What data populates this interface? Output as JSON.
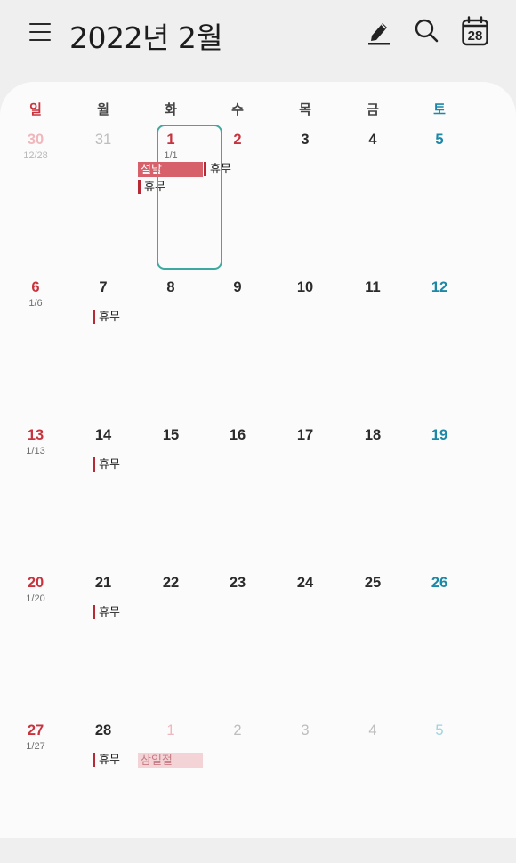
{
  "header": {
    "menu_icon": "menu-icon",
    "title": "2022년 2월",
    "today_label": "28",
    "icons": [
      "edit-pen-icon",
      "search-icon",
      "today-calendar-icon"
    ]
  },
  "colors": {
    "sunday": "#c8333e",
    "saturday": "#1a88a8",
    "selection": "#3ea9a0",
    "event_marker": "#b72a35",
    "holiday_bar": "#d6616a"
  },
  "weekdays": [
    "일",
    "월",
    "화",
    "수",
    "목",
    "금",
    "토"
  ],
  "weeks": [
    [
      {
        "day": "30",
        "lunar": "12/28",
        "muted": true
      },
      {
        "day": "31",
        "muted": true
      },
      {
        "day": "1",
        "lunar": "1/1",
        "holiday": true,
        "selected": true,
        "bar": "설날",
        "events": [
          "휴무"
        ]
      },
      {
        "day": "2",
        "holiday": true,
        "events": [
          "휴무"
        ]
      },
      {
        "day": "3"
      },
      {
        "day": "4"
      },
      {
        "day": "5"
      }
    ],
    [
      {
        "day": "6",
        "lunar": "1/6"
      },
      {
        "day": "7",
        "events": [
          "휴무"
        ]
      },
      {
        "day": "8"
      },
      {
        "day": "9"
      },
      {
        "day": "10"
      },
      {
        "day": "11"
      },
      {
        "day": "12"
      }
    ],
    [
      {
        "day": "13",
        "lunar": "1/13"
      },
      {
        "day": "14",
        "events": [
          "휴무"
        ]
      },
      {
        "day": "15"
      },
      {
        "day": "16"
      },
      {
        "day": "17"
      },
      {
        "day": "18"
      },
      {
        "day": "19"
      }
    ],
    [
      {
        "day": "20",
        "lunar": "1/20"
      },
      {
        "day": "21",
        "events": [
          "휴무"
        ]
      },
      {
        "day": "22"
      },
      {
        "day": "23"
      },
      {
        "day": "24"
      },
      {
        "day": "25"
      },
      {
        "day": "26"
      }
    ],
    [
      {
        "day": "27",
        "lunar": "1/27"
      },
      {
        "day": "28",
        "events": [
          "휴무"
        ]
      },
      {
        "day": "1",
        "muted": true,
        "holiday": true,
        "bar": "삼일절",
        "bar_pale": true
      },
      {
        "day": "2",
        "muted": true
      },
      {
        "day": "3",
        "muted": true
      },
      {
        "day": "4",
        "muted": true
      },
      {
        "day": "5",
        "muted": true
      }
    ]
  ]
}
